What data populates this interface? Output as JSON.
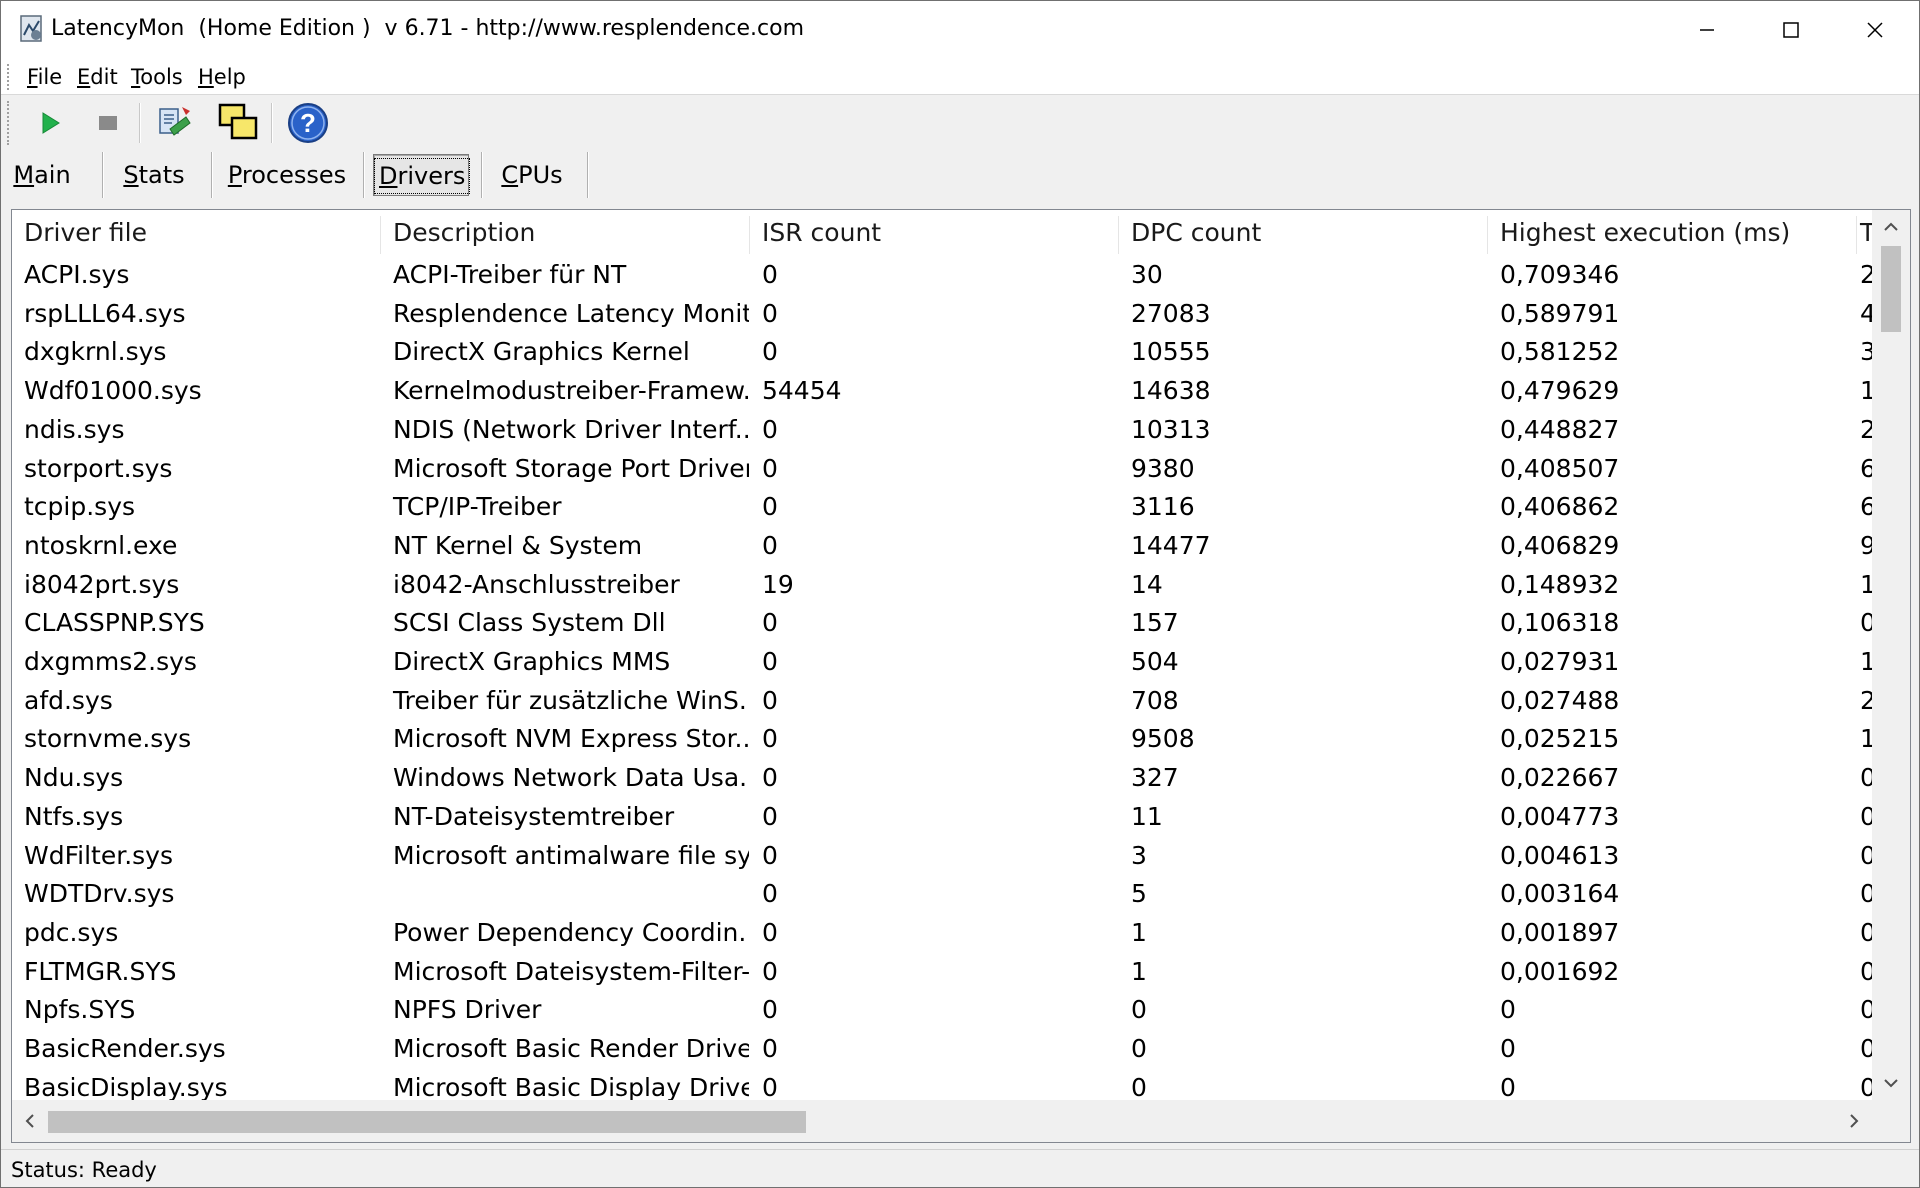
{
  "window": {
    "title": "LatencyMon  (Home Edition )  v 6.71 - http://www.resplendence.com"
  },
  "menu": [
    {
      "key": "F",
      "rest": "ile"
    },
    {
      "key": "E",
      "rest": "dit"
    },
    {
      "key": "T",
      "rest": "ools"
    },
    {
      "key": "H",
      "rest": "elp"
    }
  ],
  "toolbar": {
    "icons": [
      "play-icon",
      "stop-icon",
      "submit-report-icon",
      "windows-icon",
      "help-icon"
    ]
  },
  "tabs": [
    {
      "key": "M",
      "rest": "ain"
    },
    {
      "key": "S",
      "rest": "tats"
    },
    {
      "key": "P",
      "rest": "rocesses"
    },
    {
      "key": "D",
      "rest": "rivers"
    },
    {
      "key": "C",
      "rest": "PUs"
    }
  ],
  "active_tab": "Drivers",
  "table": {
    "columns": [
      "Driver file",
      "Description",
      "ISR count",
      "DPC count",
      "Highest execution (ms)",
      "T"
    ],
    "rows": [
      [
        "ACPI.sys",
        "ACPI-Treiber für NT",
        "0",
        "30",
        "0,709346",
        "2"
      ],
      [
        "rspLLL64.sys",
        "Resplendence Latency Monit...",
        "0",
        "27083",
        "0,589791",
        "4"
      ],
      [
        "dxgkrnl.sys",
        "DirectX Graphics Kernel",
        "0",
        "10555",
        "0,581252",
        "3"
      ],
      [
        "Wdf01000.sys",
        "Kernelmodustreiber-Framew...",
        "54454",
        "14638",
        "0,479629",
        "1"
      ],
      [
        "ndis.sys",
        "NDIS (Network Driver Interf...",
        "0",
        "10313",
        "0,448827",
        "2"
      ],
      [
        "storport.sys",
        "Microsoft Storage Port Driver",
        "0",
        "9380",
        "0,408507",
        "6"
      ],
      [
        "tcpip.sys",
        "TCP/IP-Treiber",
        "0",
        "3116",
        "0,406862",
        "6"
      ],
      [
        "ntoskrnl.exe",
        "NT Kernel & System",
        "0",
        "14477",
        "0,406829",
        "9"
      ],
      [
        "i8042prt.sys",
        "i8042-Anschlusstreiber",
        "19",
        "14",
        "0,148932",
        "1"
      ],
      [
        "CLASSPNP.SYS",
        "SCSI Class System Dll",
        "0",
        "157",
        "0,106318",
        "0"
      ],
      [
        "dxgmms2.sys",
        "DirectX Graphics MMS",
        "0",
        "504",
        "0,027931",
        "1"
      ],
      [
        "afd.sys",
        "Treiber für zusätzliche WinS...",
        "0",
        "708",
        "0,027488",
        "2"
      ],
      [
        "stornvme.sys",
        "Microsoft NVM Express Stor...",
        "0",
        "9508",
        "0,025215",
        "1"
      ],
      [
        "Ndu.sys",
        "Windows Network Data Usa...",
        "0",
        "327",
        "0,022667",
        "0"
      ],
      [
        "Ntfs.sys",
        "NT-Dateisystemtreiber",
        "0",
        "11",
        "0,004773",
        "0"
      ],
      [
        "WdFilter.sys",
        "Microsoft antimalware file sys...",
        "0",
        "3",
        "0,004613",
        "0"
      ],
      [
        "WDTDrv.sys",
        "",
        "0",
        "5",
        "0,003164",
        "0"
      ],
      [
        "pdc.sys",
        "Power Dependency Coordin...",
        "0",
        "1",
        "0,001897",
        "0"
      ],
      [
        "FLTMGR.SYS",
        "Microsoft Dateisystem-Filter-...",
        "0",
        "1",
        "0,001692",
        "0"
      ],
      [
        "Npfs.SYS",
        "NPFS Driver",
        "0",
        "0",
        "0",
        "0"
      ],
      [
        "BasicRender.sys",
        "Microsoft Basic Render Driver",
        "0",
        "0",
        "0",
        "0"
      ],
      [
        "BasicDisplay.sys",
        "Microsoft Basic Display Driver",
        "0",
        "0",
        "0",
        "0"
      ]
    ]
  },
  "status": {
    "text": "Status: Ready"
  },
  "colors": {
    "play": "#22b14c",
    "stop": "#8a8a8a",
    "help": "#2a62c9",
    "scroll_thumb": "#c1c1c1"
  }
}
